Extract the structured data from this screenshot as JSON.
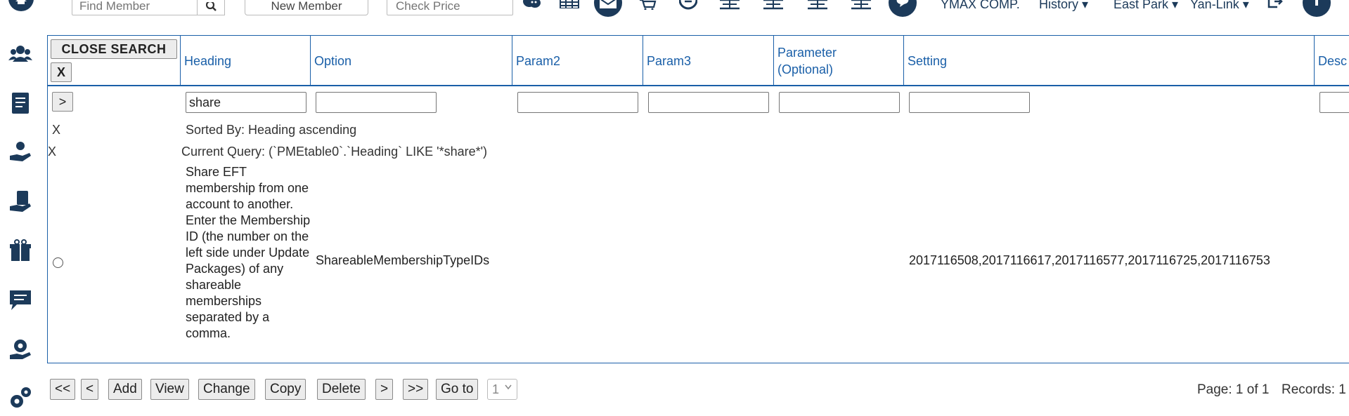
{
  "topbar": {
    "find_member_placeholder": "Find Member",
    "new_member_label": "New Member",
    "check_price_placeholder": "Check Price",
    "icons": [
      "chat-bubbles-icon",
      "calendar-grid-icon",
      "envelope-icon",
      "cart-icon",
      "clock-icon",
      "court-icon",
      "court-icon",
      "court-icon",
      "court-icon",
      "message-icon"
    ],
    "company": "YMAX COMP.",
    "history": "History",
    "location": "East Park",
    "link": "Yan-Link"
  },
  "sidebar": {
    "icons": [
      "users-icon",
      "document-icon",
      "hand-care-icon",
      "clipboard-hand-icon",
      "gift-box-icon",
      "chat-icon",
      "gear-hand-icon",
      "gears-icon"
    ]
  },
  "grid": {
    "close_search_label": "CLOSE SEARCH",
    "close_x_label": "X",
    "columns": [
      {
        "label": "Heading"
      },
      {
        "label": "Option"
      },
      {
        "label": "Param2"
      },
      {
        "label": "Param3"
      },
      {
        "label": "Parameter (Optional)"
      },
      {
        "label": "Setting"
      },
      {
        "label": "Desc"
      }
    ],
    "filter": {
      "go_label": ">",
      "heading_value": "share"
    },
    "sort": {
      "x_label": "X",
      "text": "Sorted By: Heading ascending"
    },
    "query": {
      "x_label": "X",
      "text": "Current Query: (`PMEtable0`.`Heading` LIKE '*share*')"
    },
    "rows": [
      {
        "heading": "Share EFT membership from one account to another. Enter the Membership ID (the number on the left side under Update Packages) of any shareable memberships separated by a comma.",
        "option": "ShareableMembershipTypeIDs",
        "setting": "2017116508,2017116617,2017116577,2017116725,2017116753"
      }
    ]
  },
  "pager": {
    "first": "<<",
    "prev": "<",
    "add": "Add",
    "view": "View",
    "change": "Change",
    "copy": "Copy",
    "delete": "Delete",
    "next": ">",
    "last": ">>",
    "goto": "Go to",
    "page_value": "1",
    "page_info": "Page: 1 of 1",
    "records_info": "Records: 1"
  },
  "colors": {
    "brand": "#1c3a5a",
    "accent": "#1a5fa8"
  }
}
